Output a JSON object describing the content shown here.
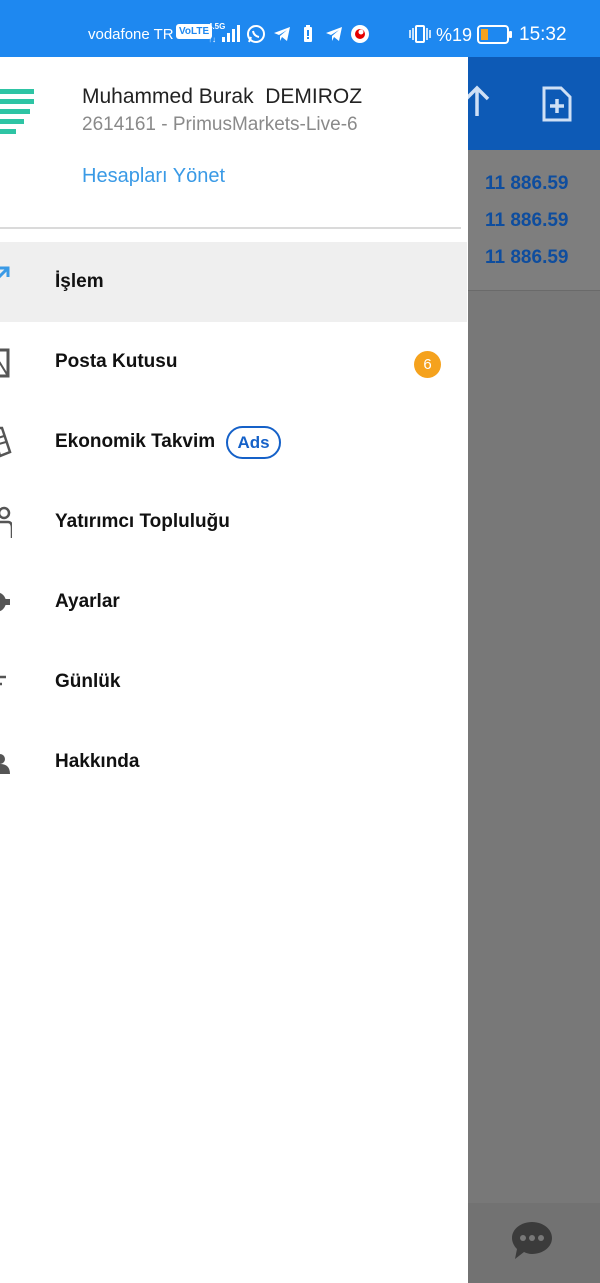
{
  "status_bar": {
    "carrier": "vodafone TR",
    "volte": "VoLTE",
    "network": "4.5G",
    "battery_percent": "%19",
    "time": "15:32",
    "icons": [
      "whatsapp-icon",
      "telegram-icon",
      "battery-alert-icon",
      "telegram-icon",
      "vodafone-icon"
    ]
  },
  "drawer": {
    "user_name": "Muhammed Burak  DEMIROZ",
    "account": "2614161 - PrimusMarkets-Live-6",
    "manage_accounts": "Hesapları Yönet",
    "menu": [
      {
        "label": "İşlem",
        "icon": "trade-arrow-icon",
        "active": true
      },
      {
        "label": "Posta Kutusu",
        "icon": "mailbox-icon",
        "badge": "6"
      },
      {
        "label": "Ekonomik Takvim",
        "icon": "calendar-icon",
        "tag": "Ads"
      },
      {
        "label": "Yatırımcı Topluluğu",
        "icon": "community-icon"
      },
      {
        "label": "Ayarlar",
        "icon": "gear-icon"
      },
      {
        "label": "Günlük",
        "icon": "journal-icon"
      },
      {
        "label": "Hakkında",
        "icon": "info-icon"
      }
    ]
  },
  "background_app": {
    "values": [
      "11 886.59",
      "11 886.59",
      "11 886.59"
    ],
    "header_icons": [
      "sort-arrow-icon",
      "new-document-icon"
    ],
    "chat_icon": "chat-icon"
  },
  "colors": {
    "status_bar": "#1e88f0",
    "header": "#0d5ab6",
    "accent_link": "#3a9ae6",
    "badge": "#f5a21d",
    "ads": "#1561c8"
  }
}
